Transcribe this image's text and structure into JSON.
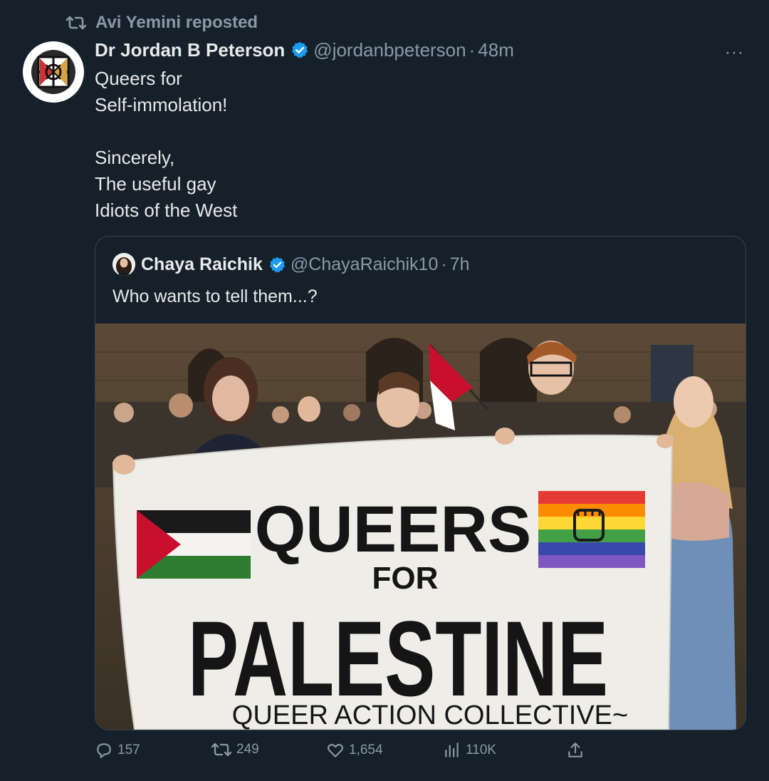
{
  "repost": {
    "label": "Avi Yemini reposted",
    "icon": "repost-icon"
  },
  "tweet": {
    "author_name": "Dr Jordan B Peterson",
    "handle": "@jordanbpeterson",
    "separator": "·",
    "time": "48m",
    "more": "···",
    "lines": [
      "Queers for",
      "Self-immolation!",
      "",
      "Sincerely,",
      "The useful gay",
      "Idiots of the West"
    ]
  },
  "quote": {
    "author_name": "Chaya Raichik",
    "handle": "@ChayaRaichik10",
    "separator": "·",
    "time": "7h",
    "text": "Who wants to tell them...?",
    "banner": {
      "line1": "QUEERS",
      "line2": "FOR",
      "line3": "PALESTINE",
      "line4": "QUEER ACTION COLLECTIVE~"
    }
  },
  "actions": {
    "replies": "157",
    "reposts": "249",
    "likes": "1,654",
    "views": "110K"
  },
  "colors": {
    "background": "#15202b",
    "text": "#e7e9ea",
    "muted": "#8b98a5",
    "verified": "#1d9bf0",
    "border": "#38444d"
  }
}
